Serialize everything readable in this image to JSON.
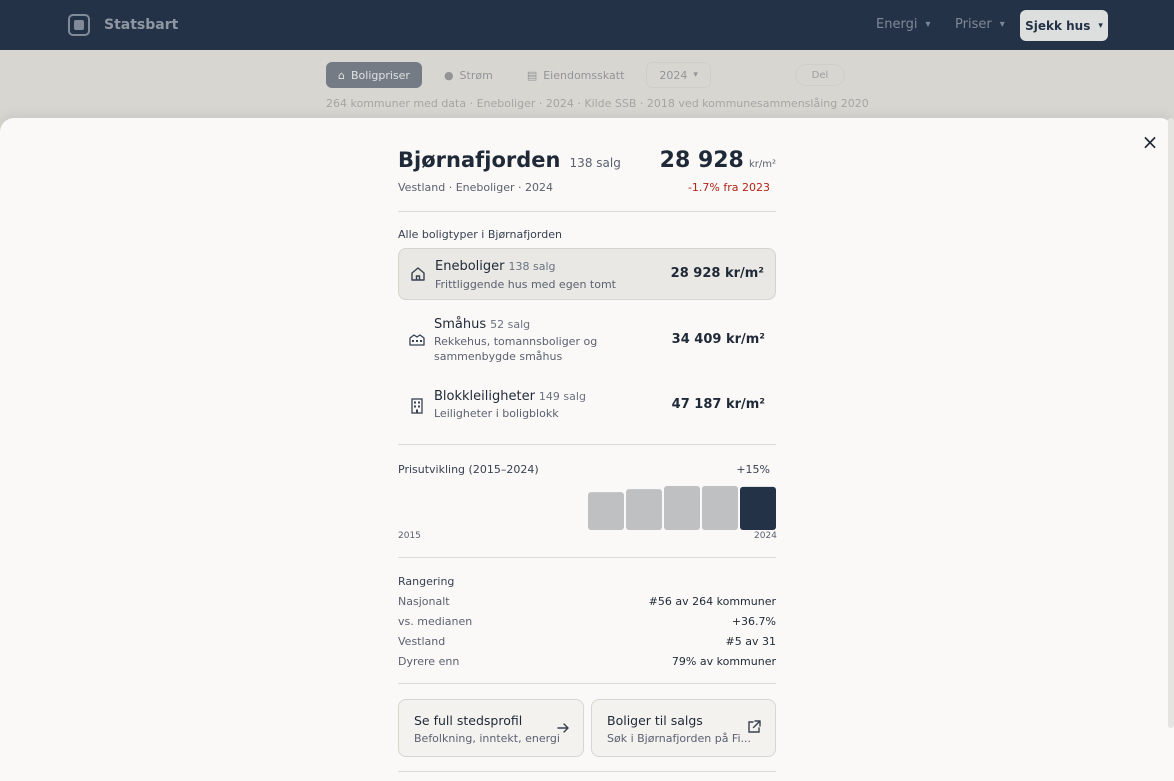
{
  "nav": {
    "app_name": "Statsbart",
    "menu1": "Energi",
    "menu2": "Priser",
    "cta": "Sjekk hus"
  },
  "toolbar": {
    "tab_active": "Boligpriser",
    "tab2": "Strøm",
    "tab3": "Eiendomsskatt",
    "year": "2024",
    "right_button": "Del",
    "subline": "264 kommuner med data · Eneboliger · 2024 · Kilde SSB · 2018 ved kommunesammenslåing 2020"
  },
  "detail": {
    "name": "Bjørnafjorden",
    "sales": "138 salg",
    "subtitle": "Vestland · Eneboliger · 2024",
    "price": "28 928",
    "unit": "kr/m²",
    "change": "-1.7% fra 2023",
    "close": "×"
  },
  "types_label": "Alle boligtyper i Bjørnafjorden",
  "types": [
    {
      "name": "Eneboliger",
      "count": "138 salg",
      "desc": "Frittliggende hus med egen tomt",
      "price": "28 928 kr/m²",
      "icon": "house-icon"
    },
    {
      "name": "Småhus",
      "count": "52 salg",
      "desc": "Rekkehus, tomannsboliger og sammenbygde småhus",
      "price": "34 409 kr/m²",
      "icon": "townhouse-icon"
    },
    {
      "name": "Blokkleiligheter",
      "count": "149 salg",
      "desc": "Leiligheter i boligblokk",
      "price": "47 187 kr/m²",
      "icon": "apartment-building-icon"
    }
  ],
  "chart_data": {
    "type": "bar",
    "title": "Prisutvikling (2015–2024)",
    "change_label": "+15%",
    "x_start_label": "2015",
    "x_end_label": "2024",
    "values": [
      0.86,
      0.93,
      1.0,
      1.0,
      0.98
    ],
    "highlight_last": true,
    "colors": {
      "bar": "#bfc0c2",
      "highlight": "#243247"
    }
  },
  "ranking": {
    "title": "Rangering",
    "rows": [
      {
        "label": "Nasjonalt",
        "value": "#56 av 264 kommuner"
      },
      {
        "label": "vs. medianen",
        "value": "+36.7%"
      },
      {
        "label": "Vestland",
        "value": "#5 av 31"
      },
      {
        "label": "Dyrere enn",
        "value": "79% av kommuner"
      }
    ]
  },
  "cards": {
    "profile_title": "Se full stedsprofil",
    "profile_sub": "Befolkning, inntekt, energi",
    "sale_title": "Boliger til salgs",
    "sale_sub": "Søk i Bjørnafjorden på Fi..."
  }
}
